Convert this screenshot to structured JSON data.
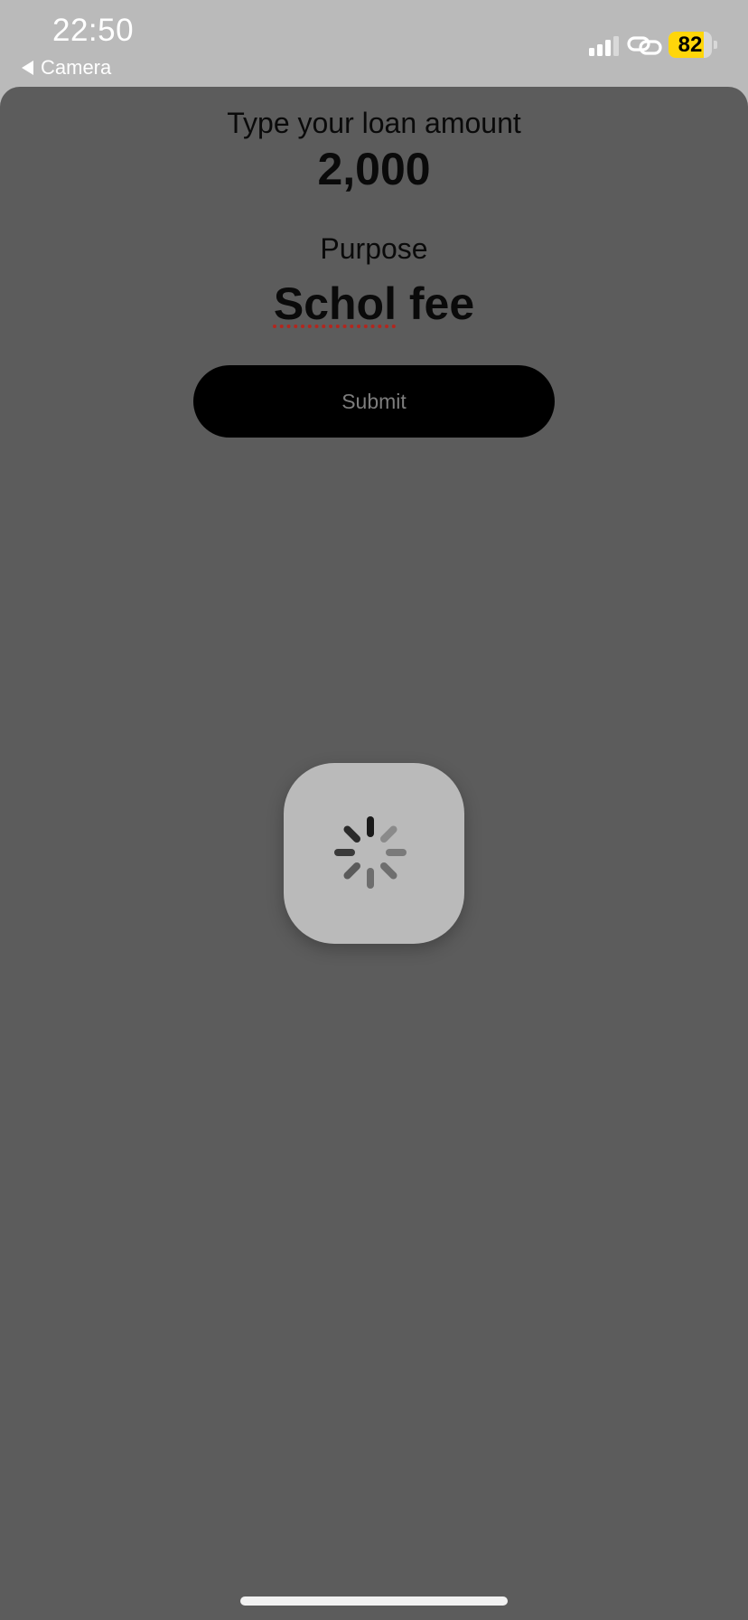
{
  "status_bar": {
    "time": "22:50",
    "back_label": "Camera",
    "battery_level": "82",
    "battery_fraction": 0.82,
    "battery_color": "#ffd60a"
  },
  "form": {
    "amount_label": "Type your loan amount",
    "amount_value": "2,000",
    "purpose_label": "Purpose",
    "purpose_misspelled": "Schol",
    "purpose_rest": " fee",
    "submit_label": "Submit"
  },
  "loader": {
    "state": "loading",
    "icon": "spinner-icon"
  },
  "colors": {
    "status_background": "#bababa",
    "sheet_background": "#5c5c5c",
    "button_background": "#000000",
    "button_text": "#7d7d7d",
    "spellcheck_underline": "#b3261e"
  }
}
